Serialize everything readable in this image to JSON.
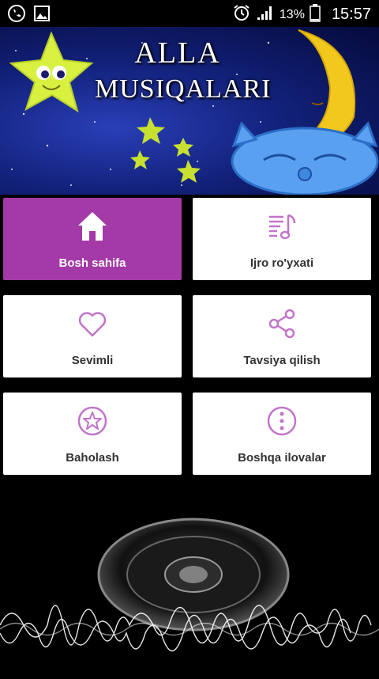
{
  "status_bar": {
    "battery_percent": "13%",
    "time": "15:57",
    "icons": [
      "phone-icon",
      "image-icon",
      "alarm-icon",
      "signal-icon",
      "battery-icon"
    ]
  },
  "banner": {
    "title_line1": "ALLA",
    "title_line2": "MUSIQALARI"
  },
  "menu": {
    "items": [
      {
        "label": "Bosh sahifa",
        "icon": "home-icon",
        "active": true
      },
      {
        "label": "Ijro ro'yxati",
        "icon": "playlist-icon",
        "active": false
      },
      {
        "label": "Sevimli",
        "icon": "heart-icon",
        "active": false
      },
      {
        "label": "Tavsiya qilish",
        "icon": "share-icon",
        "active": false
      },
      {
        "label": "Baholash",
        "icon": "star-icon",
        "active": false
      },
      {
        "label": "Boshqa ilovalar",
        "icon": "more-icon",
        "active": false
      }
    ]
  },
  "colors": {
    "accent": "#a43aa8",
    "icon_tint": "#c274c9",
    "background": "#000000"
  }
}
